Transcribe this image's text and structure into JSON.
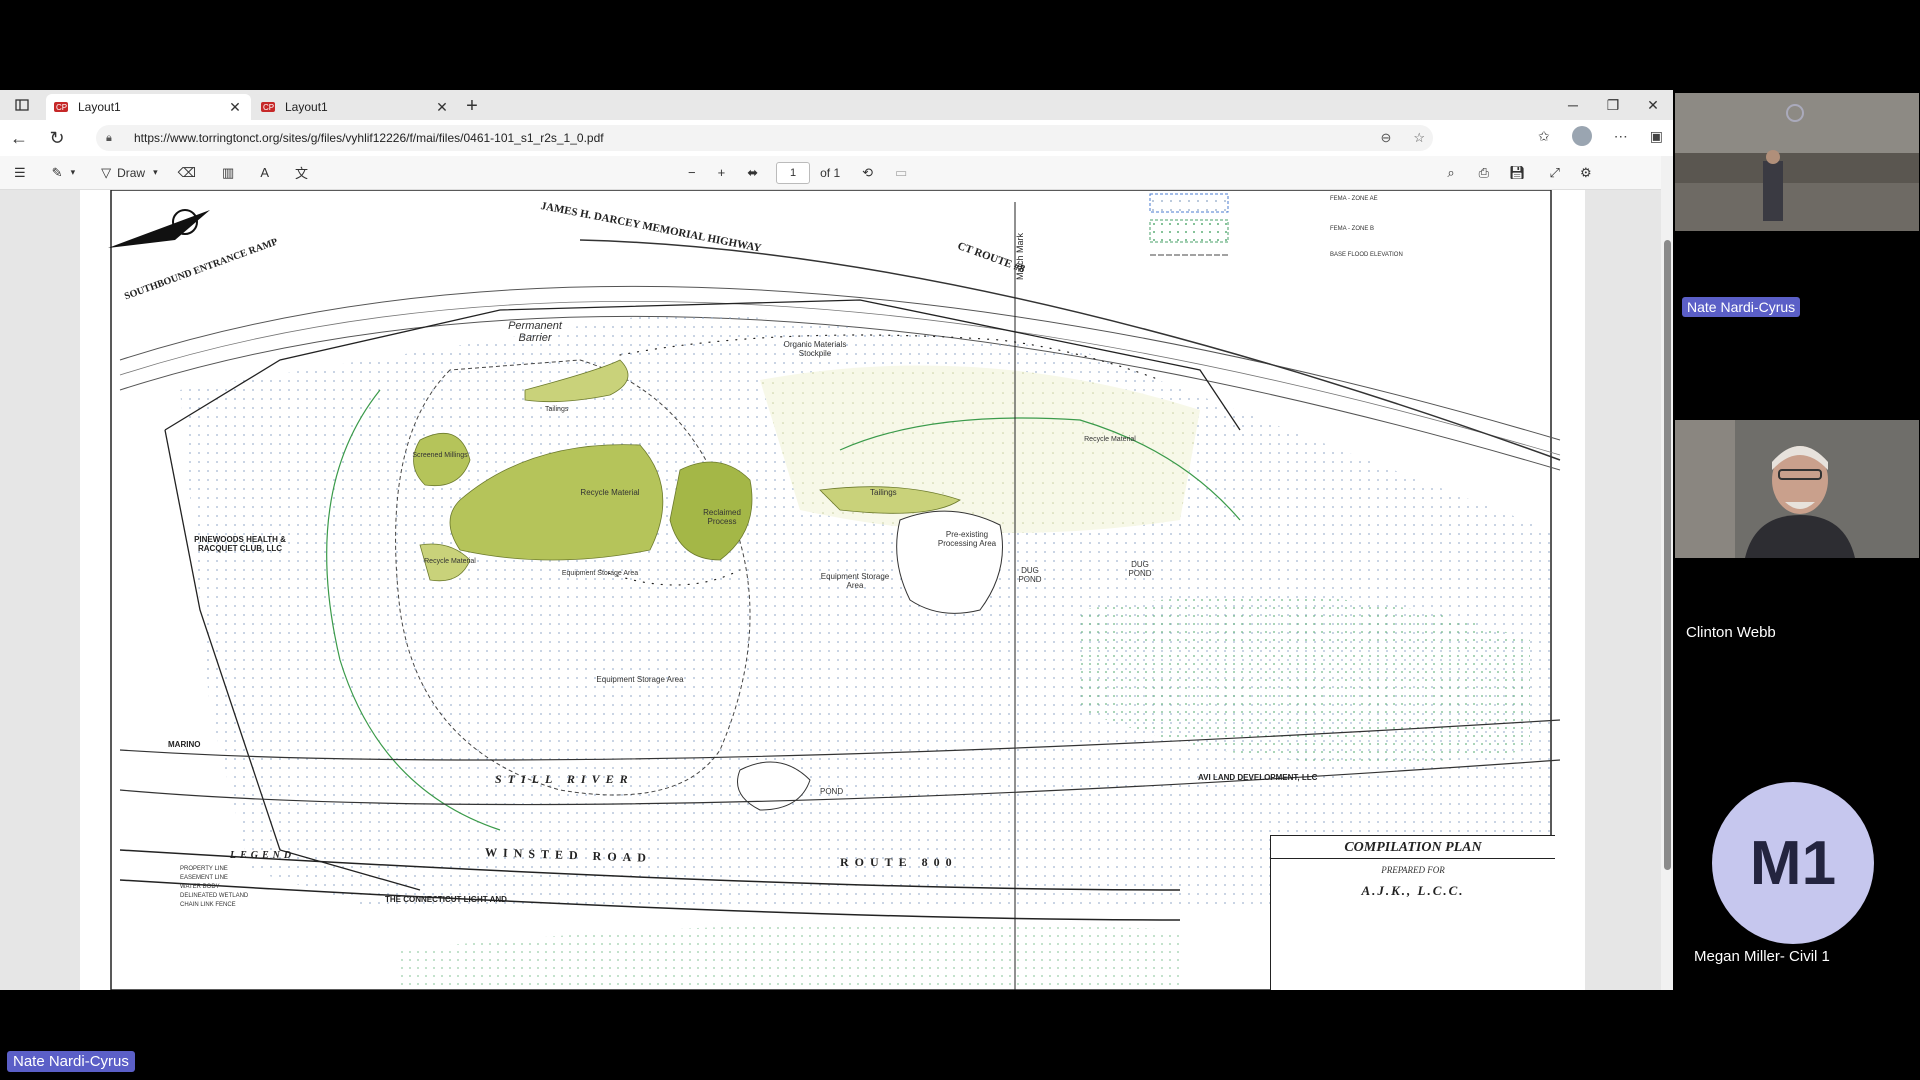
{
  "browser": {
    "tabs": [
      {
        "label": "Layout1",
        "active": true
      },
      {
        "label": "Layout1",
        "active": false
      }
    ],
    "url": "https://www.torringtonct.org/sites/g/files/vyhlif12226/f/mai/files/0461-101_s1_r2s_1_0.pdf"
  },
  "pdf_toolbar": {
    "draw_label": "Draw",
    "page_current": "1",
    "page_total": "of 1"
  },
  "plan": {
    "road_top": "JAMES H. DARCEY MEMORIAL HIGHWAY",
    "route_top": "CT ROUTE #8",
    "ramp": "SOUTHBOUND ENTRANCE RAMP",
    "road_bottom": "WINSTED ROAD",
    "route_bottom": "ROUTE 800",
    "river": "STILL RIVER",
    "permanent_barrier": "Permanent Barrier",
    "organic_stockpile": "Organic Materials Stockpile",
    "recycle_material": "Recycle Material",
    "reclaimed_process": "Reclaimed Process",
    "screened_millings": "Screened Millings",
    "tailings1": "Tailings",
    "tailings2": "Tailings",
    "recycle_material2": "Recycle Material",
    "recycle_material3": "Recycle Material",
    "equipment_storage1": "Equipment Storage Area",
    "equipment_storage2": "Equipment Storage Area",
    "equipment_storage3": "Equipment Storage Area",
    "preexisting": "Pre-existing Processing Area",
    "dug_pond": "DUG POND",
    "dug_pond2": "DUG POND",
    "pond": "POND",
    "match_mark": "Match Mark",
    "pinewoods": "PINEWOODS HEALTH & RACQUET CLUB, LLC",
    "marino": "MARINO",
    "avi": "AVI LAND DEVELOPMENT, LLC",
    "connecticut": "THE CONNECTICUT LIGHT AND",
    "legend_title": "LEGEND",
    "legend_items": [
      "PROPERTY LINE",
      "EASEMENT LINE",
      "WATER BODY",
      "DELINEATED WETLAND",
      "CHAIN LINK FENCE"
    ],
    "fema_ae": "FEMA - ZONE AE",
    "fema_b": "FEMA - ZONE B",
    "base_flood": "BASE FLOOD ELEVATION",
    "compilation_title": "COMPILATION PLAN",
    "prepared_for": "PREPARED FOR",
    "client": "A.J.K., L.C.C."
  },
  "participants": [
    {
      "name": "Nate Nardi-Cyrus"
    },
    {
      "name": "Clinton Webb"
    },
    {
      "name": "Megan Miller- Civil 1",
      "initials": "M1"
    }
  ],
  "bottom_label": "Nate Nardi-Cyrus",
  "colors": {
    "accent": "#5b5fc7",
    "fill_green": "#b5c45a",
    "dark_green": "#8fa636"
  }
}
